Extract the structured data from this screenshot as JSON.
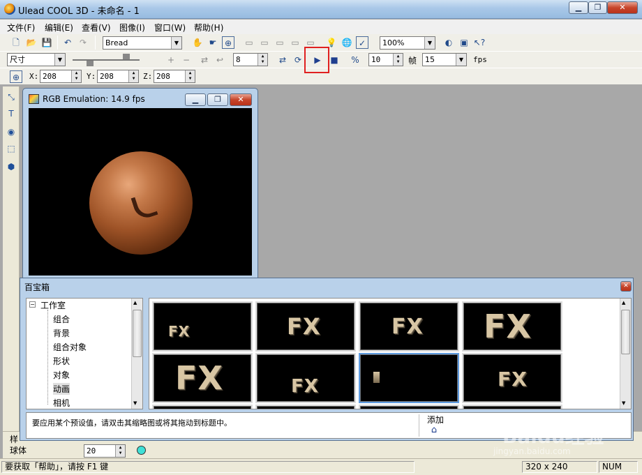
{
  "window": {
    "title": "Ulead COOL 3D - 未命名 - 1",
    "minimize": "▁",
    "restore": "❐",
    "close": "✕"
  },
  "menu": [
    "文件(F)",
    "编辑(E)",
    "查看(V)",
    "图像(I)",
    "窗口(W)",
    "帮助(H)"
  ],
  "toolbar1": {
    "font_combo": "Bread",
    "zoom_combo": "100%"
  },
  "toolbar2": {
    "attr_combo": "尺寸",
    "value_spin": "8",
    "frame_spin": "10",
    "frame_label": "帧",
    "fps_combo": "15",
    "fps_label": "fps"
  },
  "toolbar3": {
    "x_label": "X:",
    "x_value": "208",
    "y_label": "Y:",
    "y_value": "208",
    "z_label": "Z:",
    "z_value": "208"
  },
  "rgb_window": {
    "title": "RGB Emulation: 14.9 fps"
  },
  "gallery": {
    "title": "百宝箱",
    "tree_root": "工作室",
    "tree_items": [
      "组合",
      "背景",
      "组合对象",
      "形状",
      "对象",
      "动画",
      "相机"
    ],
    "thumbnails": [
      {
        "label": "FX",
        "selected": false
      },
      {
        "label": "FX",
        "selected": false
      },
      {
        "label": "FX",
        "selected": false
      },
      {
        "label": "FX",
        "selected": false
      },
      {
        "label": "FX",
        "selected": false
      },
      {
        "label": "FX",
        "selected": false
      },
      {
        "label": "",
        "selected": true
      },
      {
        "label": "FX",
        "selected": false
      }
    ],
    "hint": "要应用某个预设值，请双击其缩略图或将其拖动到标题中。",
    "add_label": "添加"
  },
  "bottom_panel": {
    "label1": "样",
    "label2": "球体",
    "spin_value": "20"
  },
  "status": {
    "help_text": "要获取「帮助」，请按 F1 键",
    "size": "320 x 240",
    "num": "NUM"
  },
  "watermark": {
    "brand": "Baidu经验",
    "url": "jingyan.baidu.com"
  },
  "colors": {
    "highlight": "#e02020",
    "selection": "#5e9be0"
  }
}
